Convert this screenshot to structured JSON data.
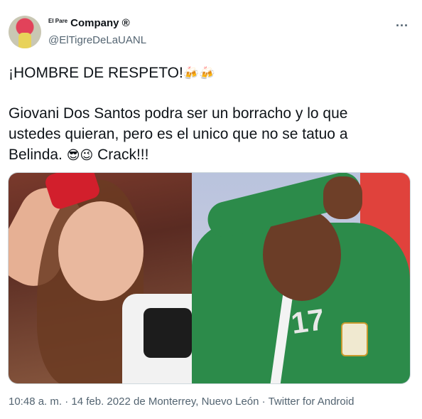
{
  "user": {
    "name_prefix": "El Pare",
    "name": "Company ®",
    "handle": "@ElTigreDeLaUANL"
  },
  "menu": {
    "more_label": "···"
  },
  "tweet": {
    "line1": "¡HOMBRE DE RESPETO!",
    "line1_emoji": "🍻🍻",
    "para2_text": "Giovani Dos Santos podra ser un borracho y lo que ustedes quieran, pero es el unico que no se tatuo a Belinda.",
    "para2_emoji": "😎😉",
    "para2_end": "Crack!!!"
  },
  "media": {
    "right_jersey_number": "17"
  },
  "footer": {
    "time": "10:48 a. m.",
    "date": "14 feb. 2022",
    "location": "de Monterrey, Nuevo León",
    "client": "Twitter for Android"
  }
}
